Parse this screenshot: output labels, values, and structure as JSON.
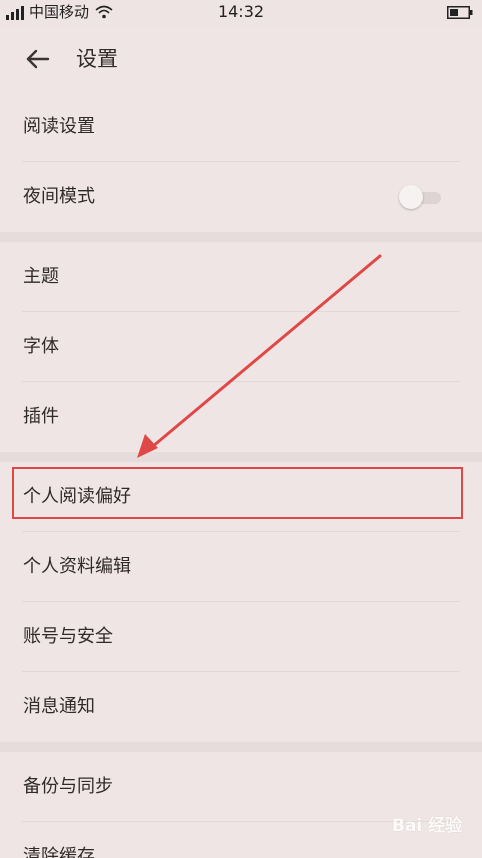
{
  "status_bar": {
    "carrier": "中国移动",
    "time": "14:32",
    "icons": [
      "signal-icon",
      "wifi-icon",
      "battery-icon"
    ]
  },
  "header": {
    "title": "设置",
    "back_icon": "arrow-left-icon"
  },
  "groups": [
    {
      "items": [
        {
          "label": "阅读设置"
        },
        {
          "label": "夜间模式",
          "toggle": false
        }
      ]
    },
    {
      "items": [
        {
          "label": "主题"
        },
        {
          "label": "字体"
        },
        {
          "label": "插件"
        }
      ]
    },
    {
      "items": [
        {
          "label": "个人阅读偏好",
          "highlighted": true
        },
        {
          "label": "个人资料编辑"
        },
        {
          "label": "账号与安全"
        },
        {
          "label": "消息通知"
        }
      ]
    },
    {
      "items": [
        {
          "label": "备份与同步"
        },
        {
          "label": "清除缓存"
        }
      ]
    }
  ],
  "annotation": {
    "highlight_color": "#e04848",
    "arrow_target": "个人阅读偏好"
  },
  "watermark": {
    "text": "Bai 经验"
  },
  "colors": {
    "background": "#efe5e4",
    "section_gap": "#e6dcdb",
    "text": "#2f2a2a"
  }
}
